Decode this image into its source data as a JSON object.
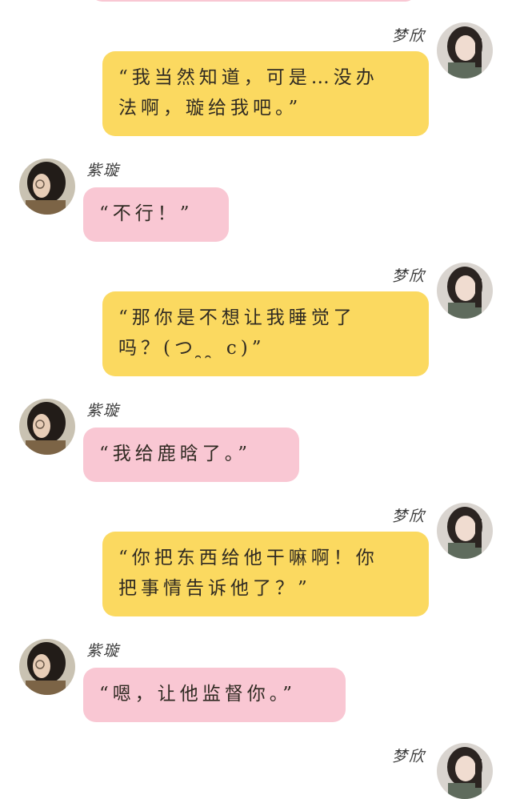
{
  "participants": {
    "right": {
      "name": "梦欣",
      "avatar_icon": "avatar-mengxin"
    },
    "left": {
      "name": "紫璇",
      "avatar_icon": "avatar-zixuan"
    }
  },
  "colors": {
    "right_bubble": "#fbd960",
    "left_bubble": "#f9c7d3"
  },
  "messages": [
    {
      "side": "right",
      "name": "梦欣",
      "text_lines": [
        "“我当然知道，可是…没办",
        "法啊，璇给我吧。”"
      ]
    },
    {
      "side": "left",
      "name": "紫璇",
      "text_lines": [
        "“不行！”"
      ]
    },
    {
      "side": "right",
      "name": "梦欣",
      "text_lines": [
        "“那你是不想让我睡觉了",
        "吗？(つ ̯ ̯ c)”"
      ]
    },
    {
      "side": "left",
      "name": "紫璇",
      "text_lines": [
        "“我给鹿晗了。”"
      ]
    },
    {
      "side": "right",
      "name": "梦欣",
      "text_lines": [
        "“你把东西给他干嘛啊！你",
        "把事情告诉他了？”"
      ]
    },
    {
      "side": "left",
      "name": "紫璇",
      "text_lines": [
        "“嗯，让他监督你。”"
      ]
    },
    {
      "side": "right",
      "name": "梦欣",
      "text_lines": []
    }
  ]
}
